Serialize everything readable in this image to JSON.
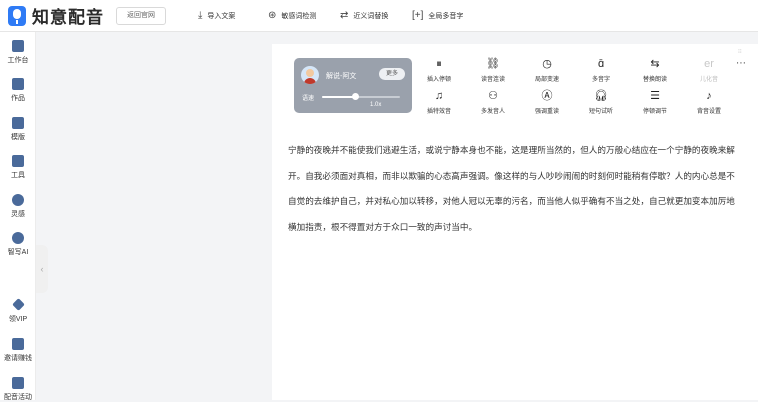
{
  "app": {
    "name": "知意配音",
    "back_label": "返回官网"
  },
  "toolbar": {
    "import": {
      "icon": "download-icon",
      "label": "导入文案"
    },
    "sensitive": {
      "icon": "search-icon",
      "label": "敏感词检测"
    },
    "synonym": {
      "icon": "swap-icon",
      "label": "近义词替换"
    },
    "polyphone": {
      "icon": "bracket-icon",
      "label": "全局多音字"
    }
  },
  "sidebar": {
    "items": [
      {
        "label": "工作台",
        "icon": "workbench-icon"
      },
      {
        "label": "作品",
        "icon": "layers-icon"
      },
      {
        "label": "模版",
        "icon": "template-icon"
      },
      {
        "label": "工具",
        "icon": "toolbox-icon"
      },
      {
        "label": "灵感",
        "icon": "hot-icon"
      },
      {
        "label": "智写AI",
        "icon": "ai-icon"
      },
      {
        "label": "领VIP",
        "icon": "diamond-icon"
      },
      {
        "label": "邀请赚钱",
        "icon": "gift-icon"
      },
      {
        "label": "配音活动",
        "icon": "bookmark-icon"
      }
    ]
  },
  "voice": {
    "name": "解说-阿文",
    "more_label": "更多",
    "speed_label": "语速",
    "speed_value": "1.0x",
    "speed_fraction": 0.42
  },
  "edit_tools": {
    "row1": [
      {
        "label": "插入停顿",
        "icon": "pause-icon",
        "enabled": true
      },
      {
        "label": "读音连读",
        "icon": "link-icon",
        "enabled": true
      },
      {
        "label": "局部变速",
        "icon": "speedometer-icon",
        "enabled": true
      },
      {
        "label": "多音字",
        "icon": "polyphone-icon",
        "enabled": true
      },
      {
        "label": "替换朗读",
        "icon": "repeat-icon",
        "enabled": true
      },
      {
        "label": "儿化音",
        "icon": "er-icon",
        "enabled": false
      }
    ],
    "row2": [
      {
        "label": "插特效音",
        "icon": "music-note-icon",
        "enabled": true
      },
      {
        "label": "多发音人",
        "icon": "multi-speaker-icon",
        "enabled": true
      },
      {
        "label": "强调重读",
        "icon": "emphasis-icon",
        "enabled": true
      },
      {
        "label": "短句试听",
        "icon": "headphones-icon",
        "enabled": true
      },
      {
        "label": "停顿调节",
        "icon": "adjust-icon",
        "enabled": true
      },
      {
        "label": "背音设置",
        "icon": "background-music-icon",
        "enabled": true
      }
    ],
    "more_icon": "ellipsis-icon",
    "scroll_hint": "⁝⁝"
  },
  "document": {
    "text": "宁静的夜晚并不能使我们逃避生活，或说宁静本身也不能，这是理所当然的，但人的万般心结应在一个宁静的夜晚来解开。自我必须面对真相，而非以欺骗的心态高声强调。像这样的与人吵吵闹闹的时刻何时能稍有停歇？人的内心总是不自觉的去维护自己，并对私心加以转移，对他人冠以无辜的污名，而当他人似乎确有不当之处，自己就更加变本加厉地横加指责，根不得置对方于众口一致的声讨当中。"
  },
  "colors": {
    "brand": "#2f7bf5",
    "voice_card": "#9aa1ac",
    "sidebar_icon": "#4a6a9a"
  }
}
